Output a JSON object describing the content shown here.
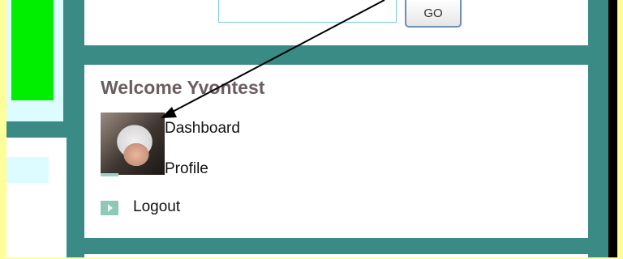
{
  "search": {
    "value": "",
    "button_label": "GO"
  },
  "welcome": {
    "title": "Welcome Yvontest"
  },
  "user_menu": {
    "dashboard_label": "Dashboard",
    "profile_label": "Profile",
    "logout_label": "Logout"
  },
  "icons": {
    "avatar": "user-avatar-photo",
    "logout": "arrow-right-icon",
    "annotation": "annotation-arrow"
  },
  "colors": {
    "frame": "#ffff99",
    "teal": "#3a8a85",
    "green": "#00ee00",
    "panel": "#ffffff",
    "light_cyan": "#ddfcff"
  }
}
